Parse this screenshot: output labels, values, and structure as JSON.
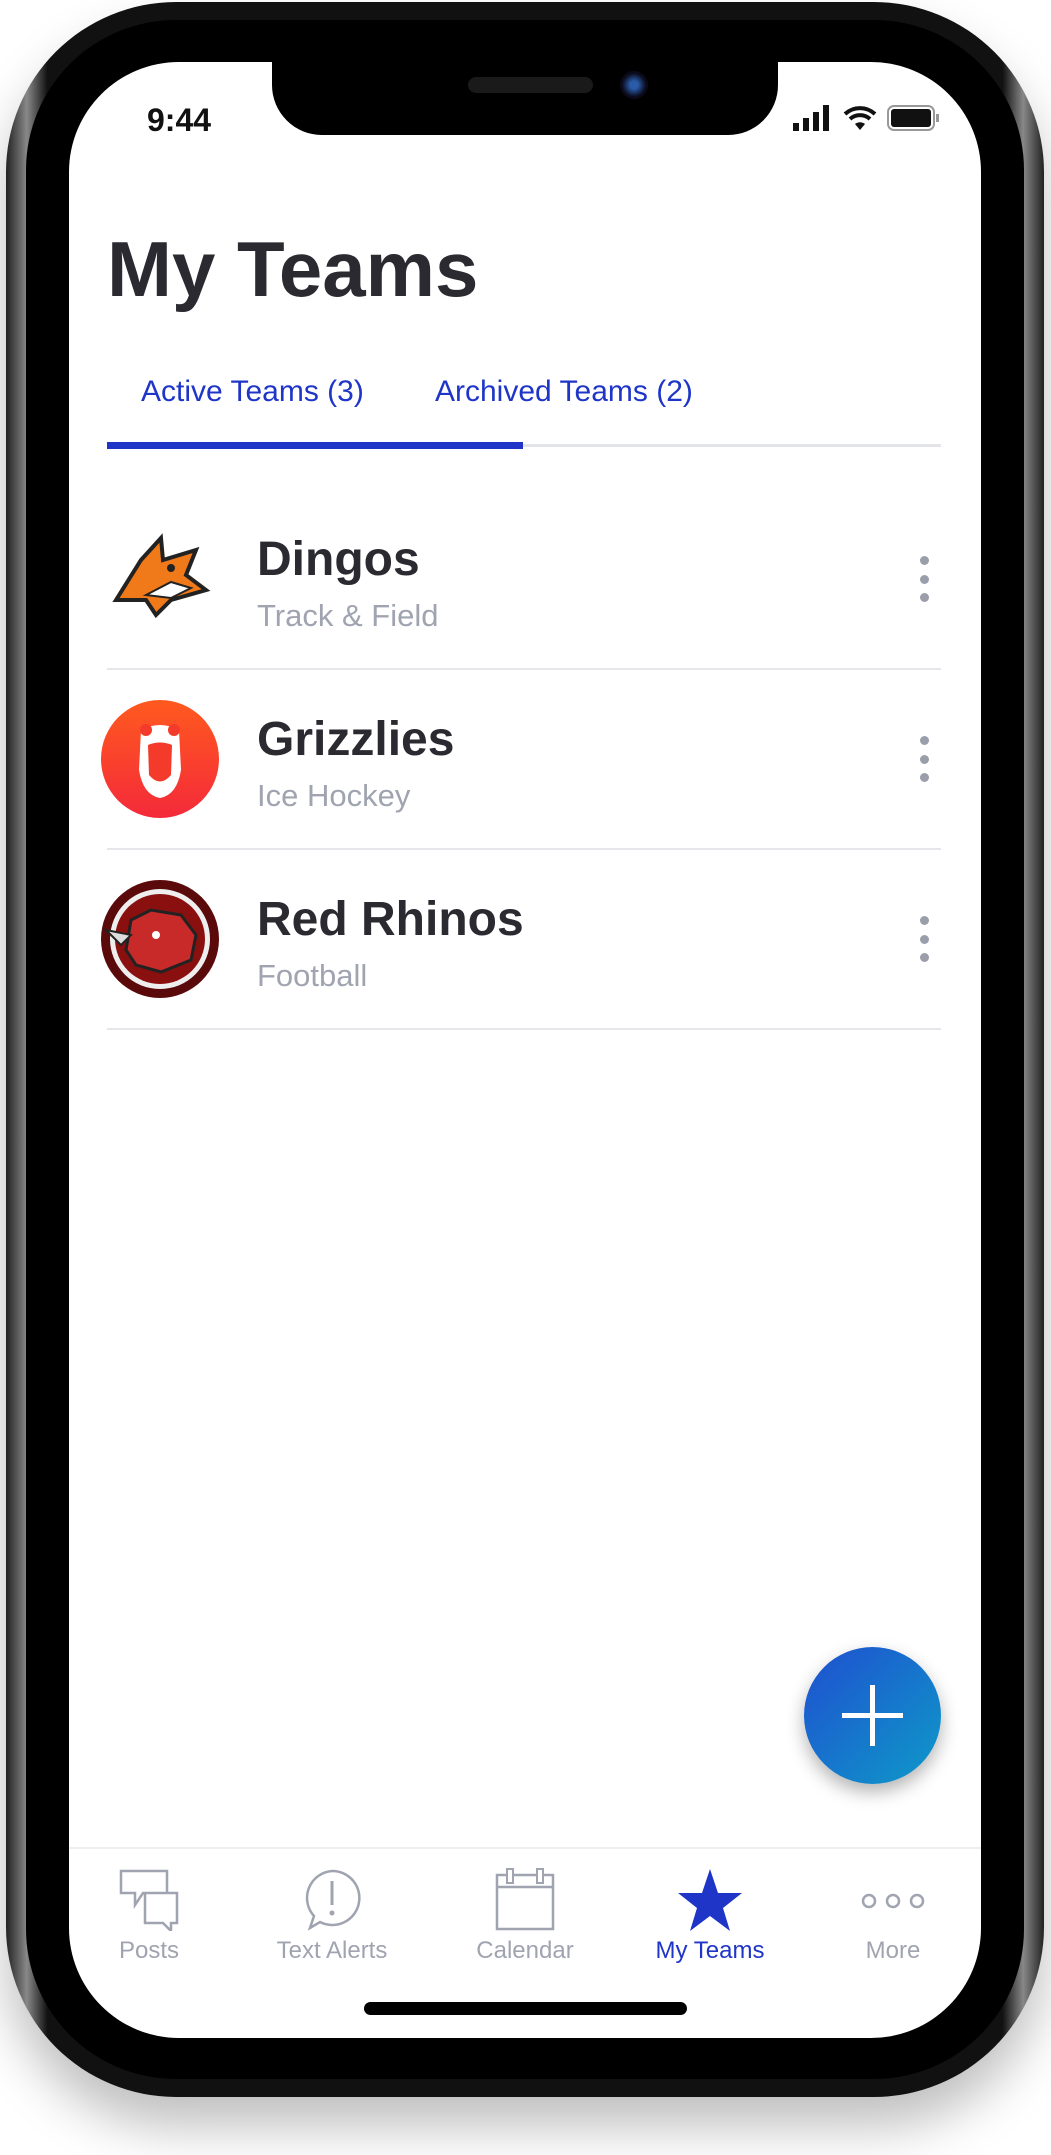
{
  "status_bar": {
    "time": "9:44",
    "icons": [
      "signal-icon",
      "wifi-icon",
      "battery-icon"
    ]
  },
  "header": {
    "title": "My Teams"
  },
  "tabs": [
    {
      "label": "Active Teams  (3)",
      "active": true
    },
    {
      "label": "Archived Teams  (2)",
      "active": false
    }
  ],
  "teams": [
    {
      "name": "Dingos",
      "sport": "Track & Field",
      "logo": "dingo-logo"
    },
    {
      "name": "Grizzlies",
      "sport": "Ice Hockey",
      "logo": "grizzly-logo"
    },
    {
      "name": "Red Rhinos",
      "sport": "Football",
      "logo": "rhino-logo"
    }
  ],
  "fab": {
    "icon": "plus-icon"
  },
  "tab_bar": {
    "items": [
      {
        "label": "Posts",
        "icon": "chat-bubbles-icon"
      },
      {
        "label": "Text Alerts",
        "icon": "alert-bubble-icon"
      },
      {
        "label": "Calendar",
        "icon": "calendar-icon"
      },
      {
        "label": "My Teams",
        "icon": "star-icon",
        "active": true
      },
      {
        "label": "More",
        "icon": "more-dots-icon"
      }
    ]
  },
  "colors": {
    "accent": "#1f35c8",
    "muted": "#a0a4b0",
    "text": "#2a2a30"
  }
}
